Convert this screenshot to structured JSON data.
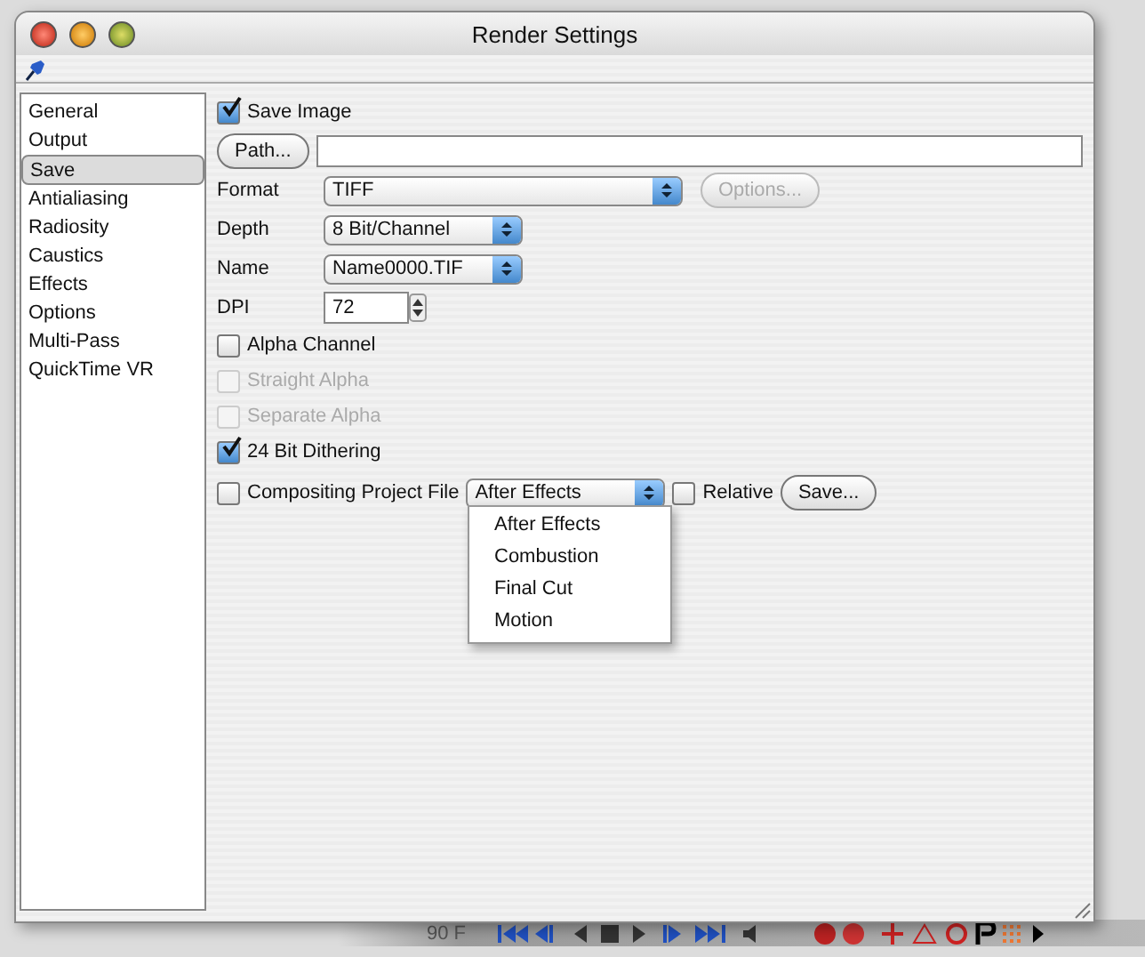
{
  "window": {
    "title": "Render Settings"
  },
  "sidebar": {
    "items": [
      {
        "label": "General",
        "selected": false
      },
      {
        "label": "Output",
        "selected": false
      },
      {
        "label": "Save",
        "selected": true
      },
      {
        "label": "Antialiasing",
        "selected": false
      },
      {
        "label": "Radiosity",
        "selected": false
      },
      {
        "label": "Caustics",
        "selected": false
      },
      {
        "label": "Effects",
        "selected": false
      },
      {
        "label": "Options",
        "selected": false
      },
      {
        "label": "Multi-Pass",
        "selected": false
      },
      {
        "label": "QuickTime VR",
        "selected": false
      }
    ]
  },
  "save_image": {
    "label": "Save Image",
    "checked": true
  },
  "path_button": {
    "label": "Path..."
  },
  "format": {
    "label": "Format",
    "value": "TIFF"
  },
  "options_button": {
    "label": "Options...",
    "disabled": true
  },
  "depth": {
    "label": "Depth",
    "value": "8 Bit/Channel"
  },
  "name": {
    "label": "Name",
    "value": "Name0000.TIF"
  },
  "dpi": {
    "label": "DPI",
    "value": "72"
  },
  "checkboxes": [
    {
      "label": "Alpha Channel",
      "checked": false,
      "disabled": false
    },
    {
      "label": "Straight Alpha",
      "checked": false,
      "disabled": true
    },
    {
      "label": "Separate Alpha",
      "checked": false,
      "disabled": true
    },
    {
      "label": "24 Bit Dithering",
      "checked": true,
      "disabled": false
    }
  ],
  "compositing": {
    "label": "Compositing Project File",
    "checked": false,
    "value": "After Effects",
    "relative": {
      "label": "Relative",
      "checked": false
    },
    "save_button": "Save...",
    "menu": [
      {
        "label": "After Effects"
      },
      {
        "label": "Combustion"
      },
      {
        "label": "Final Cut"
      },
      {
        "label": "Motion"
      }
    ]
  },
  "background_toolbar": {
    "frame": "90 F"
  }
}
